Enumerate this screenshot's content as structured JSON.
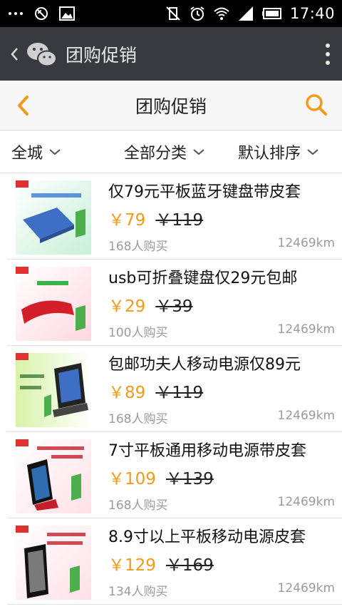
{
  "status_bar": {
    "time": "17:40",
    "left_icons": [
      "more-dots-icon",
      "no-notify-icon",
      "image-icon"
    ],
    "right_icons": [
      "vibrate-off-icon",
      "alarm-icon",
      "wifi-icon",
      "signal-icon",
      "battery-icon"
    ]
  },
  "app_bar": {
    "title": "团购促销",
    "back_icon": "chevron-left-icon",
    "logo_icon": "wechat-logo-icon",
    "menu_icon": "overflow-menu-icon",
    "bg_color": "#393a3f"
  },
  "page_header": {
    "title": "团购促销",
    "accent_color": "#f39a1b"
  },
  "filters": [
    {
      "label": "全城"
    },
    {
      "label": "全部分类"
    },
    {
      "label": "默认排序"
    }
  ],
  "products": [
    {
      "name": "仅79元平板蓝牙键盘带皮套",
      "price": "￥79",
      "original_price": "￥119",
      "sold": "168人购买",
      "distance": "12469km",
      "image": "blue-keyboard-case-image"
    },
    {
      "name": "usb可折叠键盘仅29元包邮",
      "price": "￥29",
      "original_price": "￥39",
      "sold": "100人购买",
      "distance": "12469km",
      "image": "red-folding-keyboard-image"
    },
    {
      "name": "包邮功夫人移动电源仅89元",
      "price": "￥89",
      "original_price": "￥119",
      "sold": "168人购买",
      "distance": "12469km",
      "image": "power-bank-tablet-image"
    },
    {
      "name": "7寸平板通用移动电源带皮套",
      "price": "￥109",
      "original_price": "￥139",
      "sold": "168人购买",
      "distance": "12469km",
      "image": "tablet-stand-power-image"
    },
    {
      "name": "8.9寸以上平板移动电源皮套",
      "price": "￥129",
      "original_price": "￥169",
      "sold": "134人购买",
      "distance": "12469km",
      "image": "large-tablet-case-image"
    }
  ]
}
